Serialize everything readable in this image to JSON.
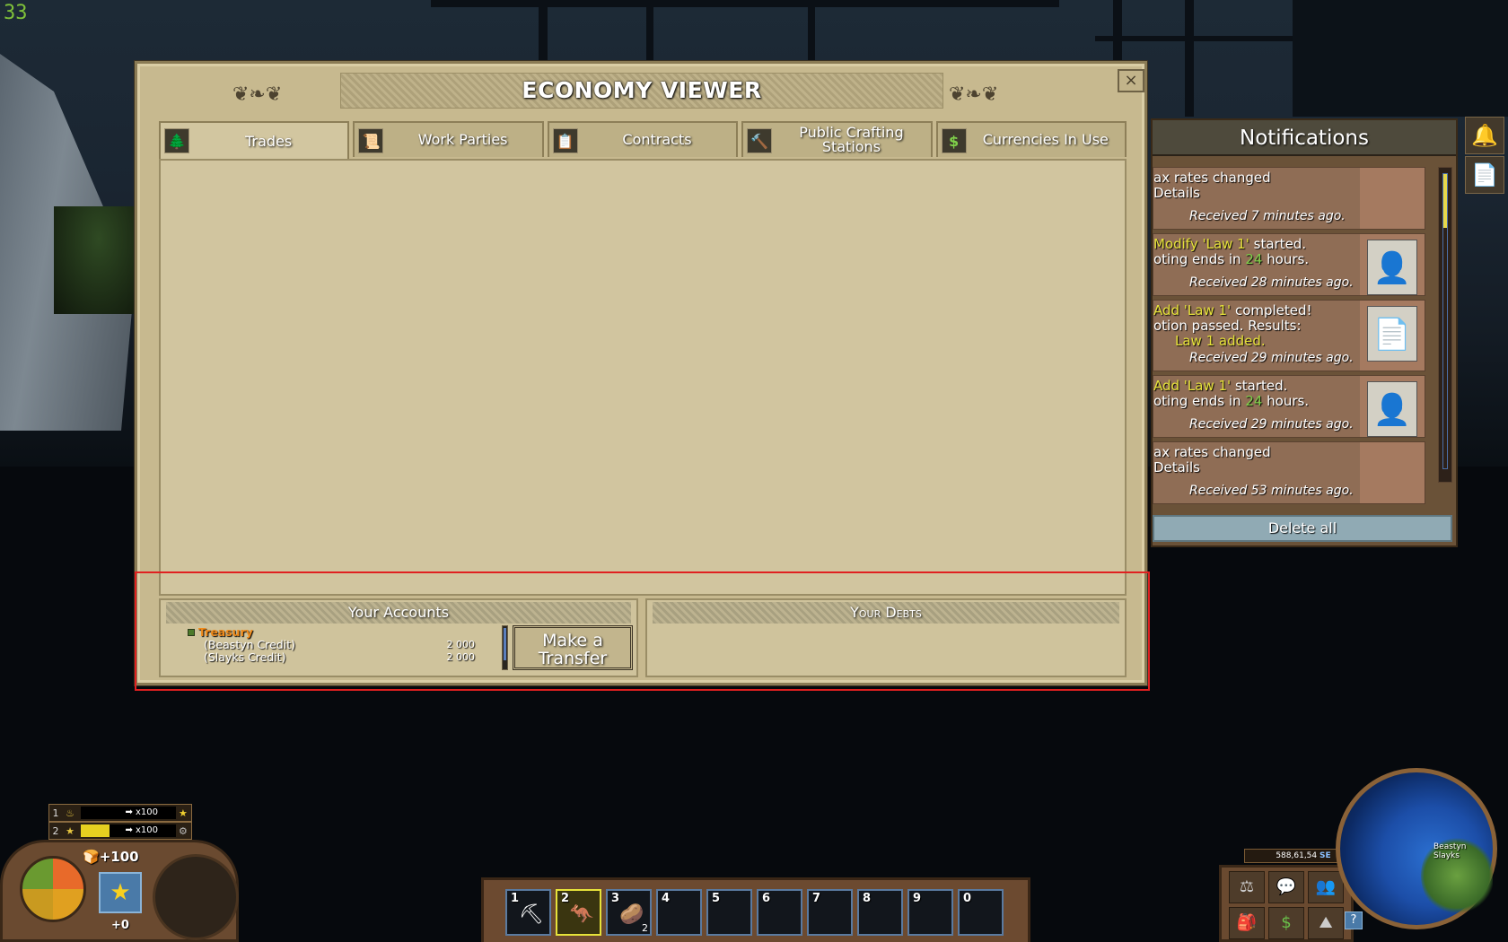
{
  "fps_counter": "33",
  "economy": {
    "title": "ECONOMY VIEWER",
    "close_label": "×",
    "tabs": [
      {
        "label": "Trades",
        "icon": "🌲",
        "active": true
      },
      {
        "label": "Work Parties",
        "icon": "📜",
        "active": false
      },
      {
        "label": "Contracts",
        "icon": "📋",
        "active": false
      },
      {
        "label": "Public Crafting Stations",
        "icon": "🔨",
        "active": false
      },
      {
        "label": "Currencies In Use",
        "icon": "$",
        "active": false
      }
    ],
    "accounts": {
      "header": "Your Accounts",
      "items": [
        {
          "name": "Treasury",
          "balances": [
            {
              "currency": "(Beastyn Credit)",
              "amount": "2 000"
            },
            {
              "currency": "(Slayks Credit)",
              "amount": "2 000"
            }
          ]
        }
      ],
      "transfer_label_1": "Make a",
      "transfer_label_2": "Transfer"
    },
    "debts": {
      "header": "Your Debts"
    }
  },
  "notifications": {
    "title": "Notifications",
    "delete_all": "Delete all",
    "items": [
      {
        "line1": "ax rates changed",
        "line1_hl": "",
        "line1_rest": "",
        "line2": "Details",
        "line2_hl": "",
        "line2_rest": "",
        "line3": "",
        "time": "Received 7 minutes ago.",
        "icon": ""
      },
      {
        "line1": "",
        "line1_hl": "Modify 'Law 1'",
        "line1_rest": " started.",
        "line2": "oting ends in ",
        "line2_hl": "24",
        "line2_rest": " hours.",
        "line3": "",
        "time": "Received 28 minutes ago.",
        "icon": "👤"
      },
      {
        "line1": "",
        "line1_hl": "Add 'Law 1'",
        "line1_rest": " completed!",
        "line2": "otion passed. Results:",
        "line2_hl": "",
        "line2_rest": "",
        "line3": "Law 1 added.",
        "time": "Received 29 minutes ago.",
        "icon": "📄"
      },
      {
        "line1": "",
        "line1_hl": "Add 'Law 1'",
        "line1_rest": " started.",
        "line2": "oting ends in ",
        "line2_hl": "24",
        "line2_rest": " hours.",
        "line3": "",
        "time": "Received 29 minutes ago.",
        "icon": "👤"
      },
      {
        "line1": "ax rates changed",
        "line1_hl": "",
        "line1_rest": "",
        "line2": "Details",
        "line2_hl": "",
        "line2_rest": "",
        "line3": "",
        "time": "Received 53 minutes ago.",
        "icon": ""
      }
    ]
  },
  "hud": {
    "stat1_num": "1",
    "stat1_value": "➡ x100",
    "stat2_num": "2",
    "stat2_value": "➡ x100",
    "food_value": "+100",
    "bottom_value": "+0",
    "hotbar": [
      {
        "num": "1",
        "art": "⛏",
        "count": "",
        "selected": false
      },
      {
        "num": "2",
        "art": "🦘",
        "count": "",
        "selected": true
      },
      {
        "num": "3",
        "art": "🥔",
        "count": "2",
        "selected": false
      },
      {
        "num": "4",
        "art": "",
        "count": "",
        "selected": false
      },
      {
        "num": "5",
        "art": "",
        "count": "",
        "selected": false
      },
      {
        "num": "6",
        "art": "",
        "count": "",
        "selected": false
      },
      {
        "num": "7",
        "art": "",
        "count": "",
        "selected": false
      },
      {
        "num": "8",
        "art": "",
        "count": "",
        "selected": false
      },
      {
        "num": "9",
        "art": "",
        "count": "",
        "selected": false
      },
      {
        "num": "0",
        "art": "",
        "count": "",
        "selected": false
      }
    ],
    "coords_value": "588,61,54",
    "coords_dir": "SE",
    "minimap_label_1": "Beastyn",
    "minimap_label_2": "Slayks",
    "help_label": "?"
  }
}
